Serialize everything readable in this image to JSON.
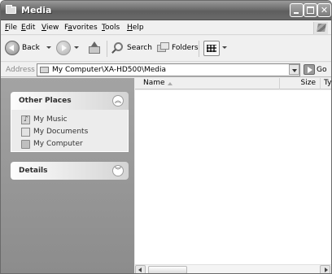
{
  "window": {
    "title": "Media"
  },
  "menubar": {
    "items": [
      {
        "underline": "F",
        "rest": "ile"
      },
      {
        "underline": "E",
        "rest": "dit"
      },
      {
        "underline": "V",
        "rest": "iew"
      },
      {
        "pre": "F",
        "underline": "a",
        "rest": "vorites"
      },
      {
        "underline": "T",
        "rest": "ools"
      },
      {
        "underline": "H",
        "rest": "elp"
      }
    ]
  },
  "toolbar": {
    "back_label": "Back",
    "search_label": "Search",
    "folders_label": "Folders"
  },
  "address": {
    "label": "Address",
    "path": "My Computer\\XA-HD500\\Media",
    "go_label": "Go"
  },
  "tasks": {
    "other_places": {
      "title": "Other Places",
      "items": [
        "My Music",
        "My Documents",
        "My Computer"
      ]
    },
    "details": {
      "title": "Details"
    }
  },
  "list": {
    "columns": {
      "name": "Name",
      "size": "Size",
      "type": "Typ"
    },
    "rows": []
  }
}
